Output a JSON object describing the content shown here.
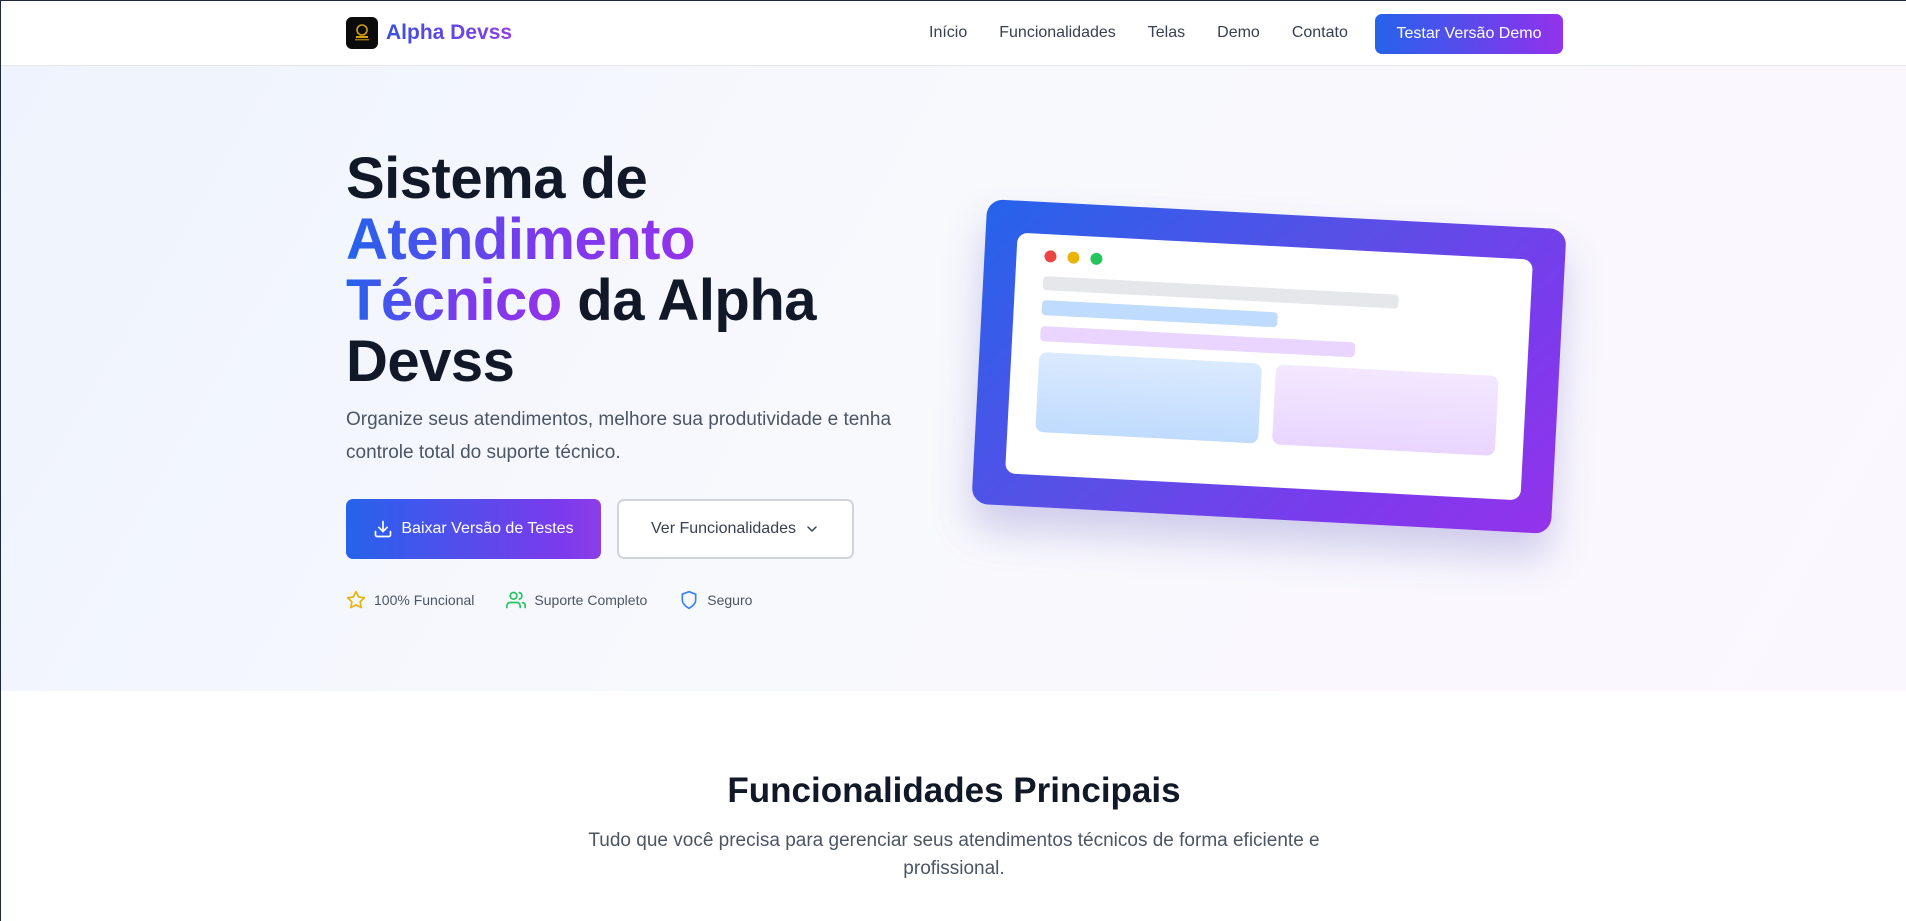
{
  "nav": {
    "brand": "Alpha Devss",
    "links": [
      "Início",
      "Funcionalidades",
      "Telas",
      "Demo",
      "Contato"
    ],
    "cta": "Testar Versão Demo"
  },
  "hero": {
    "title_line1": "Sistema de",
    "title_grad1": "Atendimento",
    "title_grad2": "Técnico",
    "title_rest": " da Alpha Devss",
    "subtitle": "Organize seus atendimentos, melhore sua produtividade e tenha controle total do suporte técnico.",
    "primary_button": "Baixar Versão de Testes",
    "secondary_button": "Ver Funcionalidades",
    "badges": [
      "100% Funcional",
      "Suporte Completo",
      "Seguro"
    ]
  },
  "features": {
    "title": "Funcionalidades Principais",
    "subtitle": "Tudo que você precisa para gerenciar seus atendimentos técnicos de forma eficiente e profissional."
  },
  "colors": {
    "accent_blue": "#2563eb",
    "accent_purple": "#9333ea",
    "star": "#eab308",
    "users": "#22c55e",
    "shield": "#3b82f6"
  },
  "icons": {
    "logo": "alpha-devss-logo",
    "download": "download-icon",
    "chevron": "chevron-down-icon",
    "star": "star-icon",
    "users": "users-icon",
    "shield": "shield-icon"
  }
}
